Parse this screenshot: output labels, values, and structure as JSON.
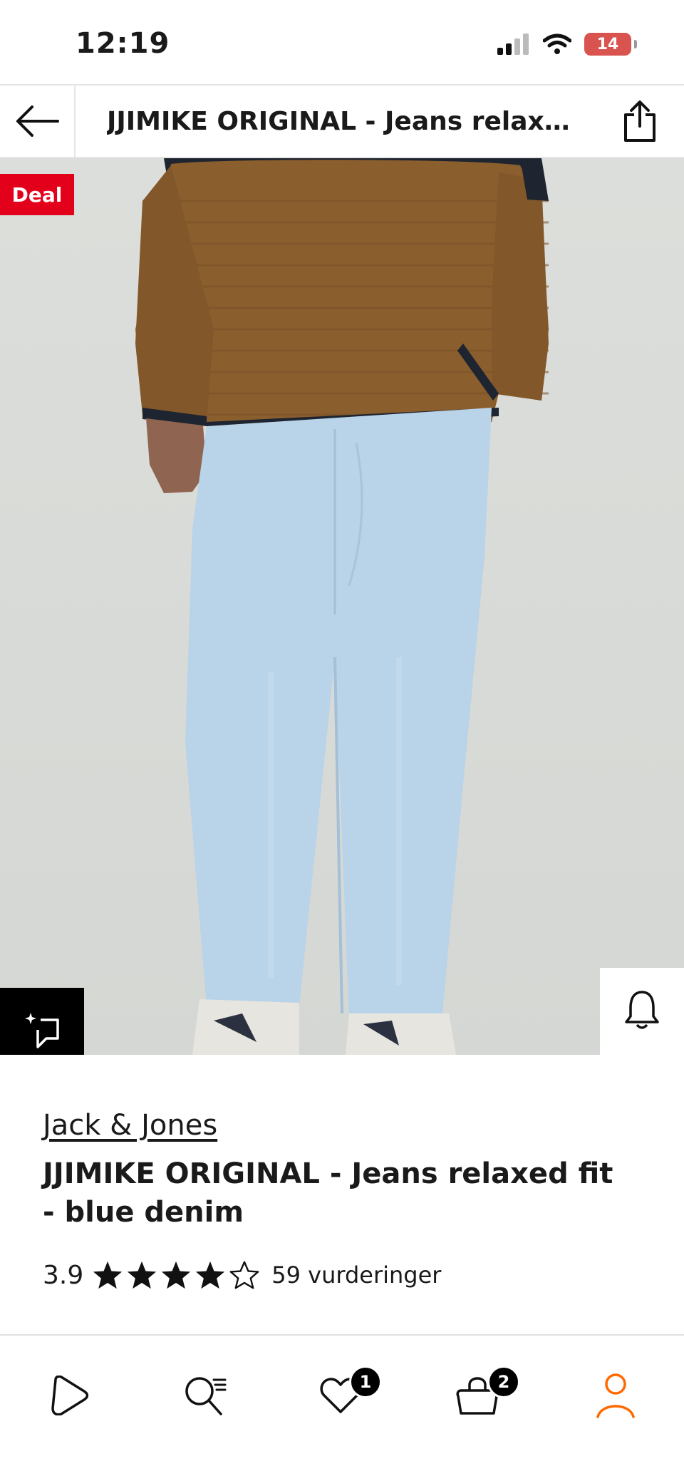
{
  "status_bar": {
    "time": "12:19",
    "battery": "14",
    "icons": [
      "signal-icon",
      "wifi-icon",
      "battery-icon"
    ]
  },
  "header": {
    "title": "JJIMIKE ORIGINAL  - Jeans relaxed fit - blue denim",
    "back_icon": "arrow-left-icon",
    "share_icon": "share-icon"
  },
  "image": {
    "deal_label": "Deal",
    "side_actions": [
      "bell-icon",
      "heart-icon",
      "bag-icon"
    ],
    "compare_icon": "compare-icon"
  },
  "product": {
    "brand": "Jack & Jones",
    "name": "JJIMIKE ORIGINAL  - Jeans relaxed fit - blue denim",
    "rating": "3.9",
    "rating_value": 3.9,
    "stars_total": 5,
    "reviews": "59 vurderinger"
  },
  "bottom_nav": {
    "items": [
      {
        "name": "play-icon"
      },
      {
        "name": "search-list-icon"
      },
      {
        "name": "heart-icon",
        "badge": "1"
      },
      {
        "name": "bag-icon",
        "badge": "2"
      },
      {
        "name": "profile-icon"
      }
    ]
  },
  "colors": {
    "accent": "#e3001b",
    "profile_active": "#ff6900",
    "sweater": "#8b5e2e",
    "denim": "#b9d3e8"
  }
}
